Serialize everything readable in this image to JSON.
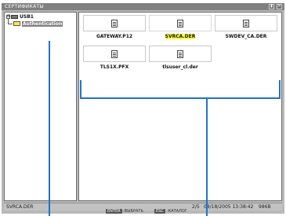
{
  "window": {
    "title": "СЕРТИФИКАТЫ",
    "minimize_icon": "minimize-icon",
    "close_icon": "close-icon"
  },
  "tree": {
    "root": {
      "label": "USB1",
      "expander": "⊟"
    },
    "child": {
      "label": "Authentication"
    }
  },
  "files": [
    {
      "name": "GATEWAY.P12",
      "selected": false
    },
    {
      "name": "SVRCA.DER",
      "selected": true
    },
    {
      "name": "SWDEV_CA.DER",
      "selected": false
    },
    {
      "name": "TLS1X.PFX",
      "selected": false
    },
    {
      "name": "tlsuser_cl.der",
      "selected": false
    }
  ],
  "status": {
    "selected_file": "SVRCA.DER",
    "position": "2/5",
    "datetime": "08/18/2005 13:38:42",
    "size": "986B"
  },
  "footer": {
    "select_key": "ENTER",
    "select_label": ":ВЫБРАТЬ",
    "catalog_key": "ESC",
    "catalog_label": ":КАТАЛОГ"
  },
  "colors": {
    "callout": "#1f74c9",
    "highlight": "#ffff3c",
    "titlebar": "#808080"
  }
}
